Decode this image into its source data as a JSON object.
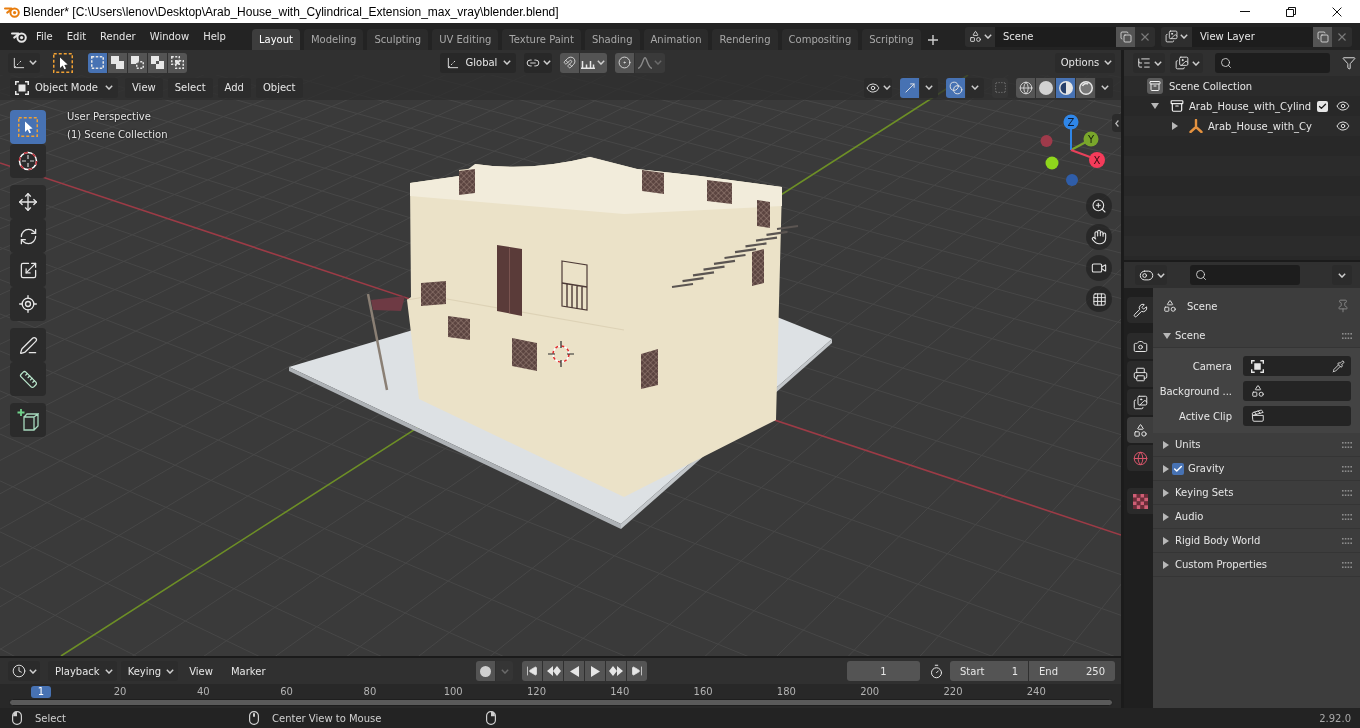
{
  "window": {
    "title": "Blender* [C:\\Users\\lenov\\Desktop\\Arab_House_with_Cylindrical_Extension_max_vray\\blender.blend]"
  },
  "menu": [
    "File",
    "Edit",
    "Render",
    "Window",
    "Help"
  ],
  "workspaces": [
    {
      "label": "Layout",
      "selected": true
    },
    {
      "label": "Modeling",
      "selected": false
    },
    {
      "label": "Sculpting",
      "selected": false
    },
    {
      "label": "UV Editing",
      "selected": false
    },
    {
      "label": "Texture Paint",
      "selected": false
    },
    {
      "label": "Shading",
      "selected": false
    },
    {
      "label": "Animation",
      "selected": false
    },
    {
      "label": "Rendering",
      "selected": false
    },
    {
      "label": "Compositing",
      "selected": false
    },
    {
      "label": "Scripting",
      "selected": false
    }
  ],
  "scene_selector": {
    "value": "Scene"
  },
  "view_layer_selector": {
    "value": "View Layer"
  },
  "viewport": {
    "tool_settings": {
      "select_modes": [
        {
          "kind": "set",
          "selected": true
        },
        {
          "kind": "extend",
          "selected": false
        },
        {
          "kind": "subtract",
          "selected": false
        },
        {
          "kind": "difference",
          "selected": false
        },
        {
          "kind": "intersect",
          "selected": false
        }
      ],
      "orientation": "Global",
      "snap": {
        "on": false
      },
      "proportional": {
        "on": false
      },
      "options": "Options"
    },
    "header": {
      "mode": "Object Mode",
      "menus": [
        "View",
        "Select",
        "Add",
        "Object"
      ],
      "gizmos": {
        "on": true
      },
      "overlays": {
        "on": true
      },
      "xray": {
        "on": false
      },
      "shading": [
        {
          "kind": "wireframe",
          "selected": false
        },
        {
          "kind": "solid",
          "selected": false
        },
        {
          "kind": "material",
          "selected": true
        },
        {
          "kind": "rendered",
          "selected": false
        }
      ]
    },
    "toolbar": [
      [
        {
          "kind": "select_box",
          "selected": true
        },
        {
          "kind": "cursor",
          "selected": false
        }
      ],
      [
        {
          "kind": "move",
          "selected": false
        },
        {
          "kind": "rotate",
          "selected": false
        },
        {
          "kind": "scale",
          "selected": false
        },
        {
          "kind": "transform",
          "selected": false
        }
      ],
      [
        {
          "kind": "annotate",
          "selected": false
        },
        {
          "kind": "measure",
          "selected": false
        }
      ],
      [
        {
          "kind": "add_cube",
          "selected": false
        }
      ]
    ],
    "info": [
      "User Perspective",
      "(1) Scene Collection"
    ],
    "navigation_gizmo": {
      "x": "X",
      "y": "Y",
      "z": "Z"
    }
  },
  "outliner": {
    "items": [
      {
        "kind": "scene_collection",
        "label": "Scene Collection",
        "children": [
          {
            "kind": "collection",
            "label": "Arab_House_with_Cylind",
            "expanded": true,
            "checked": true,
            "visible": true,
            "children": [
              {
                "kind": "empty",
                "label": "Arab_House_with_Cy",
                "expanded": false,
                "visible": true
              }
            ]
          }
        ]
      }
    ]
  },
  "properties": {
    "tabs": [
      [
        {
          "kind": "tool",
          "selected": false
        }
      ],
      [
        {
          "kind": "render",
          "selected": false
        },
        {
          "kind": "output",
          "selected": false
        },
        {
          "kind": "view_layer",
          "selected": false
        },
        {
          "kind": "scene",
          "selected": true
        },
        {
          "kind": "world",
          "selected": false
        }
      ],
      [
        {
          "kind": "texture",
          "selected": false
        }
      ]
    ],
    "context": "Scene",
    "panels": [
      {
        "title": "Scene",
        "expanded": true,
        "fields": [
          {
            "label": "Camera",
            "kind": "camera"
          },
          {
            "label": "Background ...",
            "kind": "scene"
          },
          {
            "label": "Active Clip",
            "kind": "clip"
          }
        ]
      },
      {
        "title": "Units",
        "expanded": false
      },
      {
        "title": "Gravity",
        "expanded": false,
        "toggle": {
          "checked": true
        }
      },
      {
        "title": "Keying Sets",
        "expanded": false
      },
      {
        "title": "Audio",
        "expanded": false
      },
      {
        "title": "Rigid Body World",
        "expanded": false
      },
      {
        "title": "Custom Properties",
        "expanded": false
      }
    ]
  },
  "timeline": {
    "menus": [
      {
        "label": "Playback",
        "dropdown": true
      },
      {
        "label": "Keying",
        "dropdown": true
      },
      {
        "label": "View",
        "dropdown": false
      },
      {
        "label": "Marker",
        "dropdown": false
      }
    ],
    "auto_keying": {
      "on": false
    },
    "current_frame": "1",
    "start": {
      "label": "Start",
      "value": "1"
    },
    "end": {
      "label": "End",
      "value": "250"
    },
    "playhead": "1",
    "ruler": [
      "20",
      "40",
      "60",
      "80",
      "100",
      "120",
      "140",
      "160",
      "180",
      "200",
      "220",
      "240"
    ]
  },
  "status_bar": {
    "hints": [
      {
        "kind": "left",
        "label": "Select"
      },
      {
        "kind": "middle",
        "label": "Center View to Mouse"
      },
      {
        "kind": "right"
      }
    ],
    "version": "2.92.0"
  }
}
